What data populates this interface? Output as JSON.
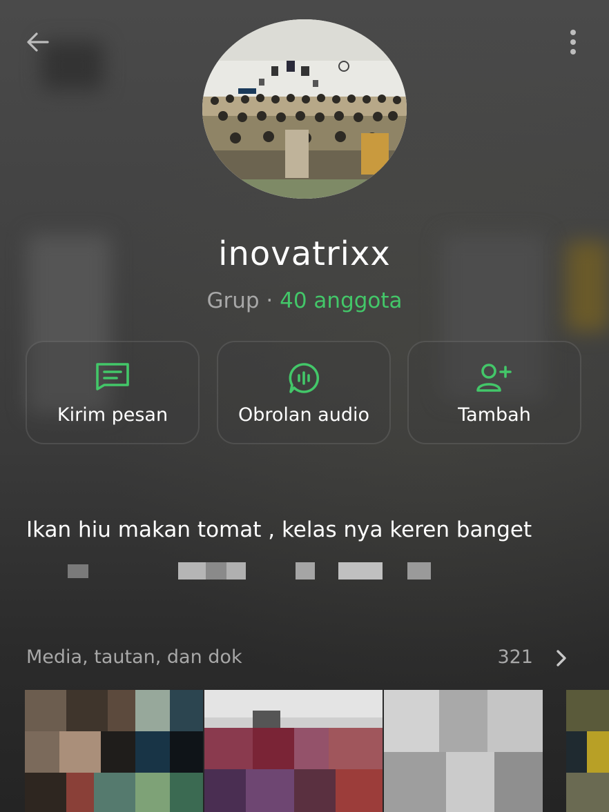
{
  "header": {
    "back_icon": "arrow-left-icon",
    "menu_icon": "more-vertical-icon"
  },
  "profile": {
    "name": "inovatrixx",
    "type_label": "Grup",
    "separator": "·",
    "members_label": "40 anggota"
  },
  "actions": [
    {
      "label": "Kirim pesan",
      "icon": "message-icon"
    },
    {
      "label": "Obrolan audio",
      "icon": "audio-chat-icon"
    },
    {
      "label": "Tambah",
      "icon": "add-person-icon"
    }
  ],
  "description": "Ikan hiu makan tomat , kelas nya keren banget",
  "media": {
    "label": "Media, tautan, dan dok",
    "count": "321"
  },
  "colors": {
    "accent": "#43c769",
    "background": "#3a3a3a",
    "secondary_text": "#a8a8a8"
  }
}
